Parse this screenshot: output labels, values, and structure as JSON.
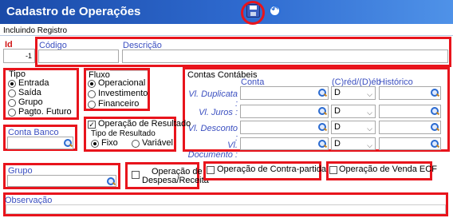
{
  "window": {
    "title": "Cadastro de Operações",
    "status": "Incluindo Registro"
  },
  "id": {
    "label": "Id",
    "value": "-1"
  },
  "codigo": {
    "label": "Código",
    "value": ""
  },
  "descricao": {
    "label": "Descrição",
    "value": ""
  },
  "tipo": {
    "label": "Tipo",
    "options": [
      "Entrada",
      "Saída",
      "Grupo",
      "Pagto. Futuro"
    ],
    "selected": "Entrada"
  },
  "fluxo": {
    "label": "Fluxo",
    "options": [
      "Operacional",
      "Investimento",
      "Financeiro"
    ],
    "selected": "Operacional"
  },
  "contas_contabeis": {
    "label": "Contas Contábeis",
    "col_conta": "Conta",
    "col_cd": "(C)réd/(D)éb",
    "col_historico": "Histórico",
    "rows": [
      {
        "label": "Vl. Duplicata :",
        "dc": "D"
      },
      {
        "label": "Vl. Juros :",
        "dc": "D"
      },
      {
        "label": "Vl. Desconto :",
        "dc": "D"
      },
      {
        "label": "Vl. Documento :",
        "dc": "D"
      }
    ]
  },
  "conta_banco": {
    "label": "Conta Banco",
    "value": ""
  },
  "resultado": {
    "check_label": "Operação de Resultado",
    "checked": true,
    "tipo_label": "Tipo de Resultado",
    "options": [
      "Fixo",
      "Variável"
    ],
    "selected": "Fixo"
  },
  "grupo": {
    "label": "Grupo",
    "value": ""
  },
  "despesa": {
    "label_line1": "Operação de",
    "label_line2": "Despesa/Receita",
    "checked": false
  },
  "contra_partida": {
    "label": "Operação de Contra-partida",
    "checked": false
  },
  "venda_ecf": {
    "label": "Operação de Venda ECF",
    "checked": false
  },
  "observacao": {
    "label": "Observação",
    "value": ""
  },
  "colors": {
    "accent_blue": "#3b4fc0",
    "highlight_red": "#e8141c",
    "title_bar": "#2f6bd0"
  }
}
